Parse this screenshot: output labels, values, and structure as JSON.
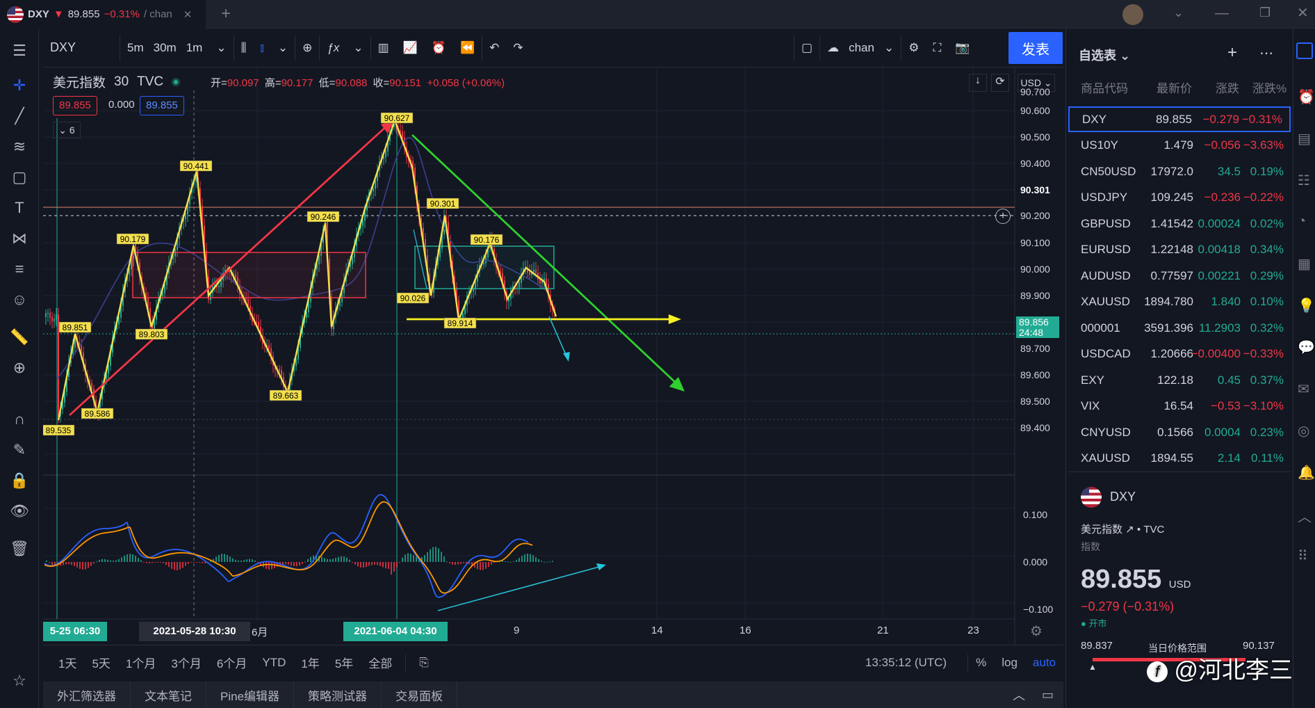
{
  "tab": {
    "symbol": "DXY",
    "arrow": "▼",
    "price": "89.855",
    "change": "−0.31%",
    "suffix": "/ chan",
    "close": "✕",
    "new": "+"
  },
  "toolbar": {
    "symbol": "DXY",
    "intervals": [
      "5m",
      "30m",
      "1m"
    ],
    "active_interval": "30m",
    "layout": "chan",
    "publish": "发表"
  },
  "legend": {
    "name": "美元指数",
    "interval": "30",
    "source": "TVC",
    "open_l": "开=",
    "open": "90.097",
    "high_l": "高=",
    "high": "90.177",
    "low_l": "低=",
    "low": "90.088",
    "close_l": "收=",
    "close": "90.151",
    "chg": "+0.058 (+0.06%)",
    "bid": "89.855",
    "spread": "0.000",
    "ask": "89.855",
    "collapse": "6",
    "currency": "USD"
  },
  "price_axis": [
    "90.700",
    "90.600",
    "90.500",
    "90.400",
    "90.301",
    "90.200",
    "90.100",
    "90.000",
    "89.900",
    "89.856",
    "24:48",
    "89.700",
    "89.600",
    "89.500",
    "89.400"
  ],
  "indicator_axis": [
    "0.100",
    "0.000",
    "−0.100"
  ],
  "time_axis": {
    "left": "5-25  06:30",
    "t1": "2021-05-28  10:30",
    "t2": "6月",
    "t3": "2021-06-04  04:30",
    "t4": "9",
    "t5": "14",
    "t6": "16",
    "t7": "21",
    "t8": "23"
  },
  "labels": {
    "p1": "90.627",
    "p2": "90.441",
    "p3": "90.179",
    "p4": "90.246",
    "p5": "90.301",
    "p6": "90.176",
    "p7": "90.026",
    "p8": "89.914",
    "p9": "89.851",
    "p10": "89.803",
    "p11": "89.586",
    "p12": "89.535",
    "p13": "89.663"
  },
  "ranges": [
    "1天",
    "5天",
    "1个月",
    "3个月",
    "6个月",
    "YTD",
    "1年",
    "5年",
    "全部"
  ],
  "clock": "13:35:12 (UTC)",
  "scale": {
    "pct": "%",
    "log": "log",
    "auto": "auto"
  },
  "bottom_tabs": [
    "外汇筛选器",
    "文本笔记",
    "Pine编辑器",
    "策略测试器",
    "交易面板"
  ],
  "watch": {
    "title": "自选表",
    "cols": [
      "商品代码",
      "最新价",
      "涨跌",
      "涨跌%"
    ],
    "rows": [
      {
        "sym": "DXY",
        "last": "89.855",
        "chg": "−0.279",
        "pct": "−0.31%",
        "dir": "down"
      },
      {
        "sym": "US10Y",
        "last": "1.479",
        "chg": "−0.056",
        "pct": "−3.63%",
        "dir": "down"
      },
      {
        "sym": "CN50USD",
        "last": "17972.0",
        "chg": "34.5",
        "pct": "0.19%",
        "dir": "up"
      },
      {
        "sym": "USDJPY",
        "last": "109.245",
        "chg": "−0.236",
        "pct": "−0.22%",
        "dir": "down"
      },
      {
        "sym": "GBPUSD",
        "last": "1.41542",
        "chg": "0.00024",
        "pct": "0.02%",
        "dir": "up"
      },
      {
        "sym": "EURUSD",
        "last": "1.22148",
        "chg": "0.00418",
        "pct": "0.34%",
        "dir": "up"
      },
      {
        "sym": "AUDUSD",
        "last": "0.77597",
        "chg": "0.00221",
        "pct": "0.29%",
        "dir": "up"
      },
      {
        "sym": "XAUUSD",
        "last": "1894.780",
        "chg": "1.840",
        "pct": "0.10%",
        "dir": "up"
      },
      {
        "sym": "000001",
        "last": "3591.396",
        "chg": "11.2903",
        "pct": "0.32%",
        "dir": "up"
      },
      {
        "sym": "USDCAD",
        "last": "1.20666",
        "chg": "−0.00400",
        "pct": "−0.33%",
        "dir": "down"
      },
      {
        "sym": "EXY",
        "last": "122.18",
        "chg": "0.45",
        "pct": "0.37%",
        "dir": "up"
      },
      {
        "sym": "VIX",
        "last": "16.54",
        "chg": "−0.53",
        "pct": "−3.10%",
        "dir": "down"
      },
      {
        "sym": "CNYUSD",
        "last": "0.1566",
        "chg": "0.0004",
        "pct": "0.23%",
        "dir": "up"
      },
      {
        "sym": "XAUUSD",
        "last": "1894.55",
        "chg": "2.14",
        "pct": "0.11%",
        "dir": "up"
      }
    ]
  },
  "detail": {
    "sym": "DXY",
    "name": "美元指数",
    "source": "TVC",
    "type": "指数",
    "price": "89.855",
    "unit": "USD",
    "chg": "−0.279 (−0.31%)",
    "status": "开市",
    "low": "89.837",
    "range_label": "当日价格范围",
    "high": "90.137"
  },
  "watermark": "@河北李三"
}
